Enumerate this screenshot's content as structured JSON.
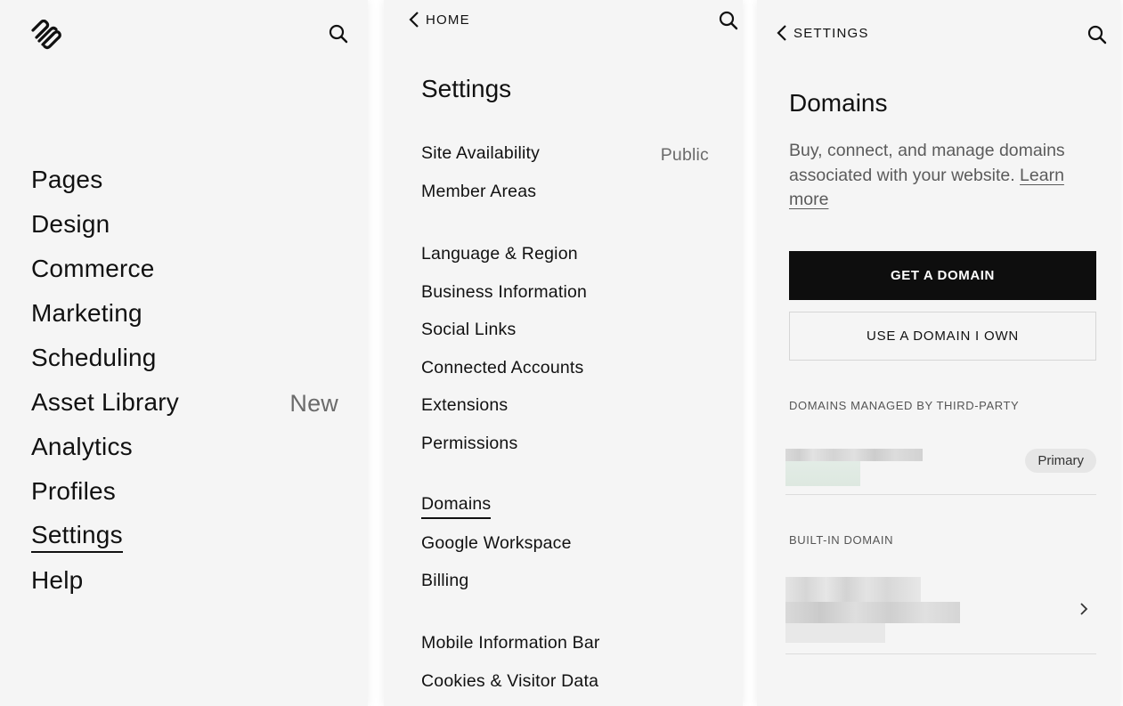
{
  "nav": {
    "logo_icon": "squarespace-logo-icon",
    "items": [
      {
        "label": "Pages"
      },
      {
        "label": "Design"
      },
      {
        "label": "Commerce"
      },
      {
        "label": "Marketing"
      },
      {
        "label": "Scheduling"
      },
      {
        "label": "Asset Library",
        "badge": "New"
      },
      {
        "label": "Analytics"
      },
      {
        "label": "Profiles"
      },
      {
        "label": "Settings",
        "active": true
      },
      {
        "label": "Help"
      }
    ]
  },
  "settings": {
    "back_label": "HOME",
    "title": "Settings",
    "groups": [
      [
        {
          "label": "Site Availability",
          "value": "Public"
        },
        {
          "label": "Member Areas"
        }
      ],
      [
        {
          "label": "Language & Region"
        },
        {
          "label": "Business Information"
        },
        {
          "label": "Social Links"
        },
        {
          "label": "Connected Accounts"
        },
        {
          "label": "Extensions"
        },
        {
          "label": "Permissions"
        }
      ],
      [
        {
          "label": "Domains",
          "active": true
        },
        {
          "label": "Google Workspace"
        },
        {
          "label": "Billing"
        }
      ],
      [
        {
          "label": "Mobile Information Bar"
        },
        {
          "label": "Cookies & Visitor Data"
        }
      ]
    ]
  },
  "domains": {
    "back_label": "SETTINGS",
    "title": "Domains",
    "description": "Buy, connect, and manage domains associated with your website. ",
    "learn_more": "Learn more",
    "get_domain_label": "GET A DOMAIN",
    "use_domain_label": "USE A DOMAIN I OWN",
    "third_party_heading": "DOMAINS MANAGED BY THIRD-PARTY",
    "primary_badge": "Primary",
    "builtin_heading": "BUILT-IN DOMAIN"
  },
  "colors": {
    "panel_bg": "#f5f5f5",
    "primary_button": "#0e0e0e",
    "muted_text": "#6b6b6b"
  }
}
